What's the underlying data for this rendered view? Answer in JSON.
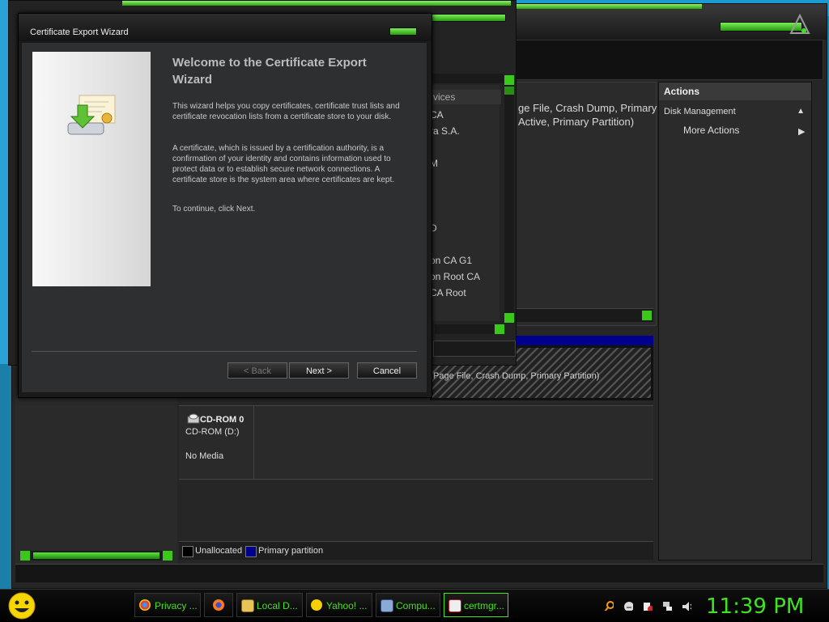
{
  "cm": {
    "center_lines": [
      "ge File, Crash Dump, Primary",
      "Active, Primary Partition)"
    ],
    "disk_part_text": "Page File, Crash Dump, Primary Partition)",
    "cdrom": {
      "title": "CD-ROM 0",
      "drive": "CD-ROM (D:)",
      "status": "No Media"
    },
    "legend": {
      "unallocated": "Unallocated",
      "primary": "Primary partition"
    },
    "actions": {
      "header": "Actions",
      "section": "Disk Management",
      "more": "More Actions"
    }
  },
  "certmgr": {
    "column_header": "vices",
    "items": [
      "CA",
      "ra S.A.",
      "M",
      "D",
      "on CA G1",
      "on Root CA",
      "CA Root"
    ]
  },
  "wizard": {
    "title": "Certificate Export Wizard",
    "heading": "Welcome to the Certificate Export Wizard",
    "para1": "This wizard helps you copy certificates, certificate trust lists and certificate revocation lists from a certificate store to your disk.",
    "para2": "A certificate, which is issued by a certification authority, is a confirmation of your identity and contains information used to protect data or to establish secure network connections. A certificate store is the system area where certificates are kept.",
    "para3": "To continue, click Next.",
    "back": "< Back",
    "next": "Next >",
    "cancel": "Cancel"
  },
  "taskbar": {
    "items": [
      "Privacy ...",
      "",
      "Local D...",
      "Yahoo! ...",
      "Compu...",
      "certmgr..."
    ],
    "clock": "11:39 PM"
  },
  "colors": {
    "accent_green": "#3ee420",
    "partition_blue": "#00008a"
  }
}
